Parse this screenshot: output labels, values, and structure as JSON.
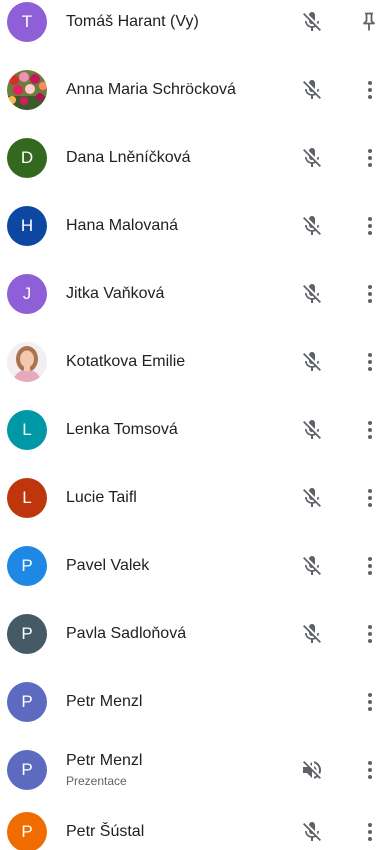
{
  "participants": [
    {
      "initial": "T",
      "name": "Tomáš Harant (Vy)",
      "avatar_color": "#8e5fd6",
      "mic": "muted",
      "action": "pin-icon"
    },
    {
      "initial": "",
      "name": "Anna Maria Schröcková",
      "avatar_type": "photo-tulips",
      "mic": "muted",
      "action": "more-vert-icon"
    },
    {
      "initial": "D",
      "name": "Dana Lněníčková",
      "avatar_color": "#33691e",
      "mic": "muted",
      "action": "more-vert-icon"
    },
    {
      "initial": "H",
      "name": "Hana Malovaná",
      "avatar_color": "#0d47a1",
      "mic": "muted",
      "action": "more-vert-icon"
    },
    {
      "initial": "J",
      "name": "Jitka Vaňková",
      "avatar_color": "#8e5fd6",
      "mic": "muted",
      "action": "more-vert-icon"
    },
    {
      "initial": "",
      "name": "Kotatkova Emilie",
      "avatar_type": "photo-portrait",
      "mic": "muted",
      "action": "more-vert-icon"
    },
    {
      "initial": "L",
      "name": "Lenka Tomsová",
      "avatar_color": "#0097a7",
      "mic": "muted",
      "action": "more-vert-icon"
    },
    {
      "initial": "L",
      "name": "Lucie Taifl",
      "avatar_color": "#bf360c",
      "mic": "muted",
      "action": "more-vert-icon"
    },
    {
      "initial": "P",
      "name": "Pavel Valek",
      "avatar_color": "#1e88e5",
      "mic": "muted",
      "action": "more-vert-icon"
    },
    {
      "initial": "P",
      "name": "Pavla Sadloňová",
      "avatar_color": "#455a64",
      "mic": "muted",
      "action": "more-vert-icon"
    },
    {
      "initial": "P",
      "name": "Petr Menzl",
      "avatar_color": "#5c6bc0",
      "mic": "none",
      "action": "more-vert-icon"
    },
    {
      "initial": "P",
      "name": "Petr Menzl",
      "subtitle": "Prezentace",
      "avatar_color": "#5c6bc0",
      "mic": "volume-off",
      "action": "more-vert-icon"
    },
    {
      "initial": "P",
      "name": "Petr Šústal",
      "avatar_color": "#ef6c00",
      "mic": "muted",
      "action": "more-vert-icon"
    }
  ]
}
